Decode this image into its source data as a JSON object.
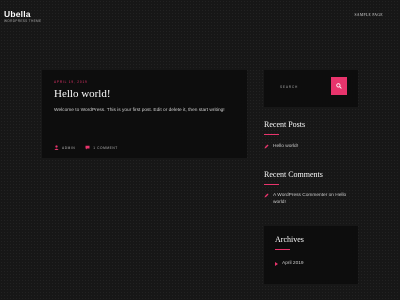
{
  "site": {
    "title": "Ubella",
    "tagline": "WORDPRESS THEME"
  },
  "nav": {
    "sample_page": "SAMPLE PAGE"
  },
  "post": {
    "date": "APRIL 19, 2019",
    "title": "Hello world!",
    "excerpt": "Welcome to WordPress. This is your first post. Edit or delete it, then start writing!",
    "author": "ADMIN",
    "comments": "1 COMMENT"
  },
  "search": {
    "placeholder": "SEARCH"
  },
  "recent_posts": {
    "title": "Recent Posts",
    "items": [
      "Hello world!"
    ]
  },
  "recent_comments": {
    "title": "Recent Comments",
    "items": [
      "A WordPress Commenter on Hello world!"
    ]
  },
  "archives": {
    "title": "Archives",
    "items": [
      "April 2019"
    ]
  },
  "colors": {
    "accent": "#e8346c",
    "background": "#171717",
    "card": "#0d0d0d"
  },
  "icons": [
    "user-icon",
    "comment-icon",
    "search-icon",
    "pen-icon",
    "caret-icon"
  ]
}
